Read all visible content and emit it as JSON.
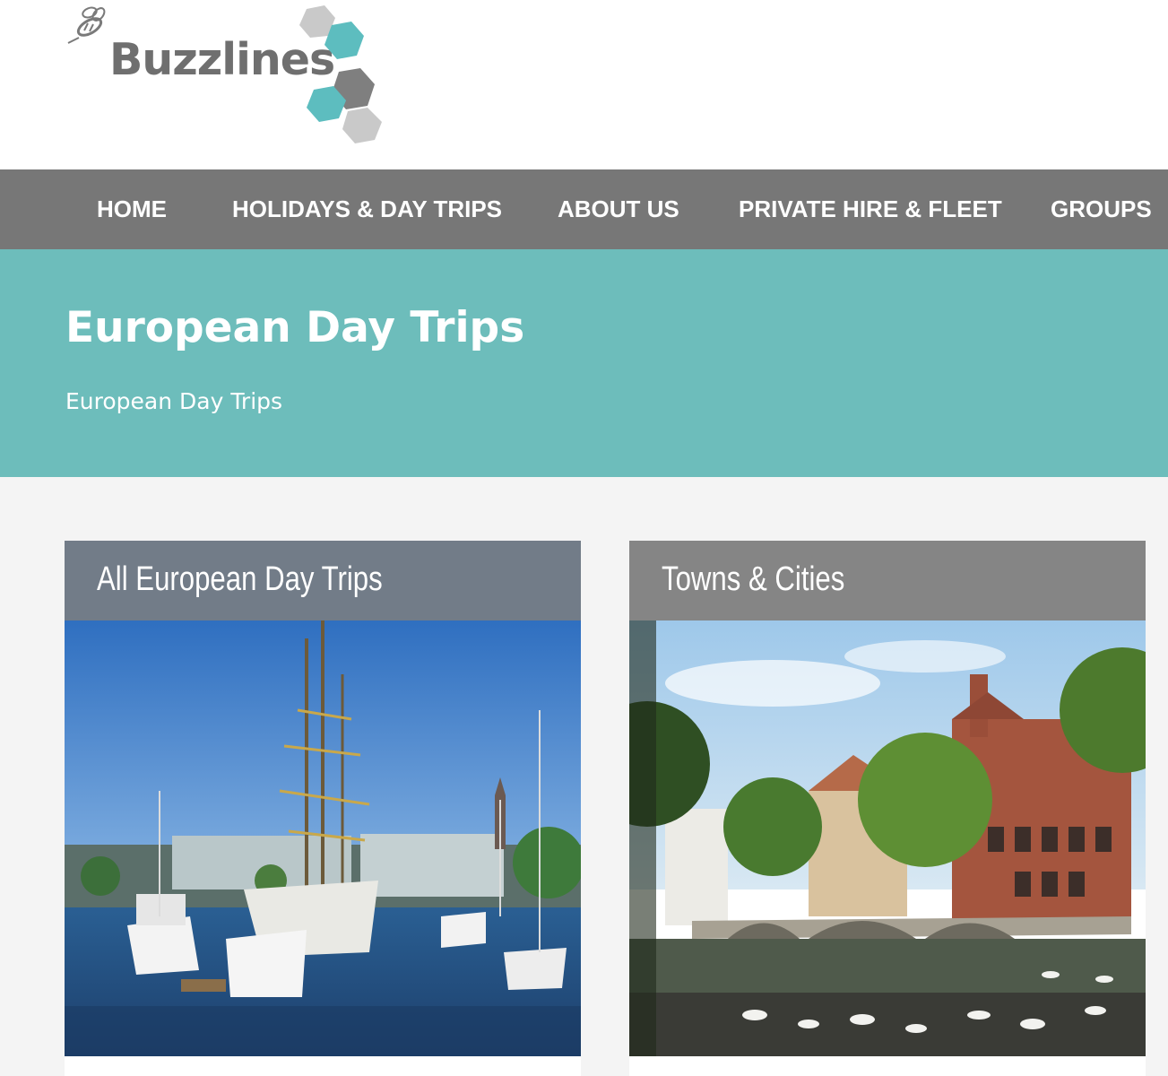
{
  "logo": {
    "text": "Buzzlines",
    "icon": "bee-icon"
  },
  "nav": {
    "items": [
      {
        "label": "HOME"
      },
      {
        "label": "HOLIDAYS & DAY TRIPS"
      },
      {
        "label": "ABOUT US"
      },
      {
        "label": "PRIVATE HIRE & FLEET"
      },
      {
        "label": "GROUPS"
      }
    ]
  },
  "hero": {
    "title": "European Day Trips",
    "breadcrumb": "European Day Trips"
  },
  "cards": [
    {
      "title": "All European Day Trips",
      "image": "harbour-tall-ship-photo"
    },
    {
      "title": "Towns & Cities",
      "image": "canal-bridge-town-photo"
    }
  ],
  "colors": {
    "nav_bg": "#777777",
    "hero_bg": "#6dbdbb",
    "card_header_bg": "#727c88",
    "logo_teal": "#5dbdbf",
    "logo_grey": "#8a8a8a"
  }
}
